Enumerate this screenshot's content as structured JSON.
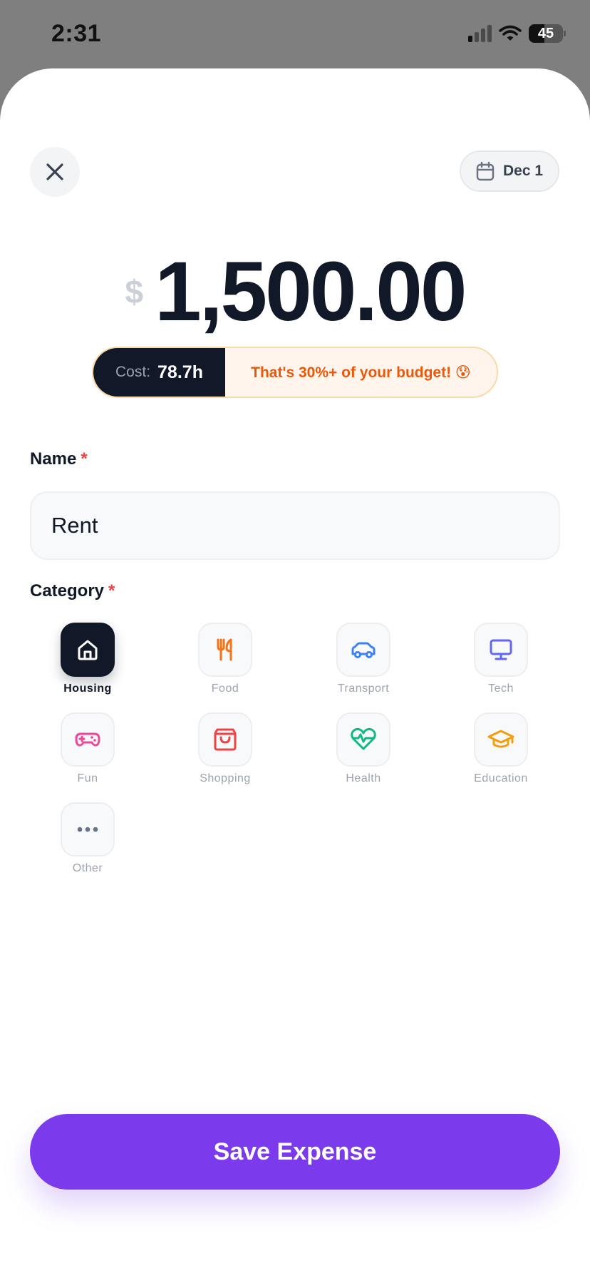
{
  "status_bar": {
    "time": "2:31",
    "battery": "45",
    "battery_level": 0.45
  },
  "header": {
    "date_label": "Dec 1"
  },
  "amount": {
    "currency": "$",
    "value": "1,500.00"
  },
  "cost": {
    "label": "Cost:",
    "value": "78.7h",
    "warning": "That's 30%+ of your budget! 😰"
  },
  "name": {
    "label": "Name",
    "required_mark": "*",
    "value": "Rent"
  },
  "category": {
    "label": "Category",
    "required_mark": "*",
    "items": [
      {
        "label": "Housing",
        "icon": "house-icon",
        "color": "#ffffff",
        "selected": true
      },
      {
        "label": "Food",
        "icon": "utensils-icon",
        "color": "#f97316"
      },
      {
        "label": "Transport",
        "icon": "car-icon",
        "color": "#3b82f6"
      },
      {
        "label": "Tech",
        "icon": "monitor-icon",
        "color": "#6366f1"
      },
      {
        "label": "Fun",
        "icon": "gamepad-icon",
        "color": "#ec4899"
      },
      {
        "label": "Shopping",
        "icon": "shopping-bag-icon",
        "color": "#ef4444"
      },
      {
        "label": "Health",
        "icon": "heart-pulse-icon",
        "color": "#10b981"
      },
      {
        "label": "Education",
        "icon": "graduation-cap-icon",
        "color": "#f59e0b"
      },
      {
        "label": "Other",
        "icon": "more-icon",
        "color": "#64748b"
      }
    ]
  },
  "actions": {
    "save_label": "Save Expense"
  },
  "colors": {
    "accent": "#7c3aed",
    "dark": "#111827",
    "warning": "#ea580c",
    "required": "#ef4444"
  }
}
